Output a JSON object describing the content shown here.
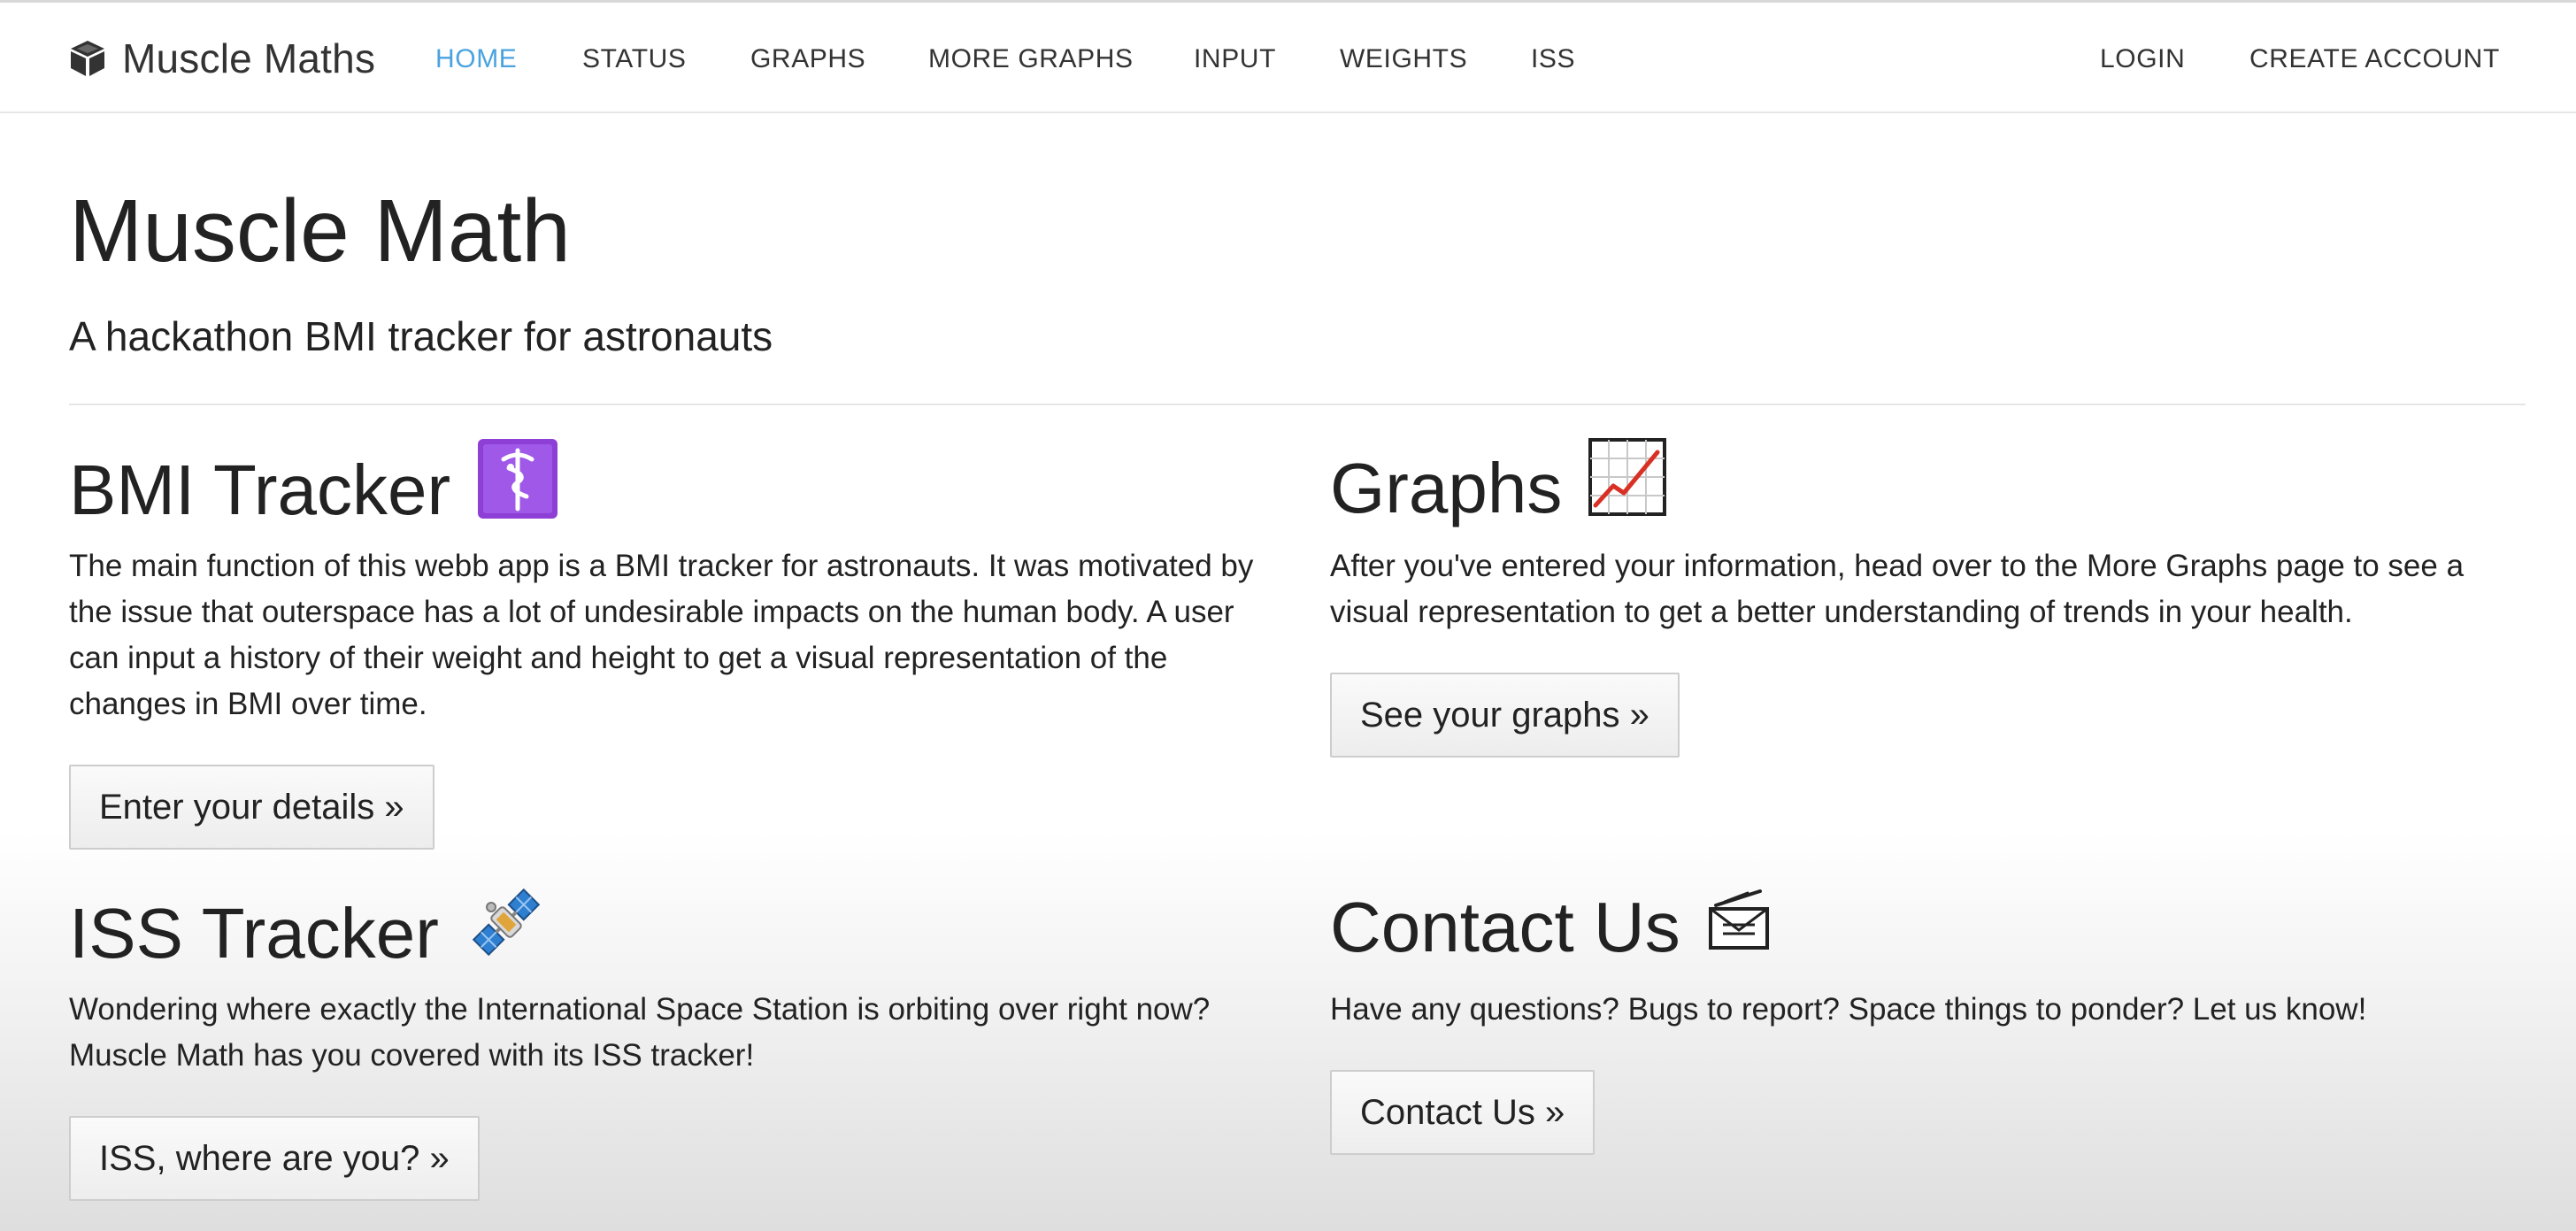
{
  "navbar": {
    "brand": "Muscle Maths",
    "brand_icon": "cube-icon",
    "items": [
      {
        "label": "HOME",
        "active": true
      },
      {
        "label": "STATUS",
        "active": false
      },
      {
        "label": "GRAPHS",
        "active": false
      },
      {
        "label": "MORE GRAPHS",
        "active": false
      },
      {
        "label": "INPUT",
        "active": false
      },
      {
        "label": "WEIGHTS",
        "active": false
      },
      {
        "label": "ISS",
        "active": false
      }
    ],
    "right_items": [
      {
        "label": "LOGIN"
      },
      {
        "label": "CREATE ACCOUNT"
      }
    ],
    "active_color": "#4aa3df"
  },
  "hero": {
    "title": "Muscle Math",
    "subtitle": "A hackathon BMI tracker for astronauts"
  },
  "sections": [
    {
      "title": "BMI Tracker",
      "icon": "medical-symbol-icon",
      "text": "The main function of this webb app is a BMI tracker for astronauts. It was motivated by the issue that outerspace has a lot of undesirable impacts on the human body. A user can input a history of their weight and height to get a visual representation of the changes in BMI over time.",
      "button": "Enter your details »"
    },
    {
      "title": "Graphs",
      "icon": "chart-increasing-icon",
      "text": "After you've entered your information, head over to the More Graphs page to see a visual representation to get a better understanding of trends in your health.",
      "button": "See your graphs »"
    },
    {
      "title": "ISS Tracker",
      "icon": "satellite-icon",
      "text": "Wondering where exactly the International Space Station is orbiting over right now? Muscle Math has you covered with its ISS tracker!",
      "button": "ISS, where are you? »"
    },
    {
      "title": "Contact Us",
      "icon": "incoming-envelope-icon",
      "text": "Have any questions? Bugs to report? Space things to ponder? Let us know!",
      "button": "Contact Us »"
    }
  ]
}
